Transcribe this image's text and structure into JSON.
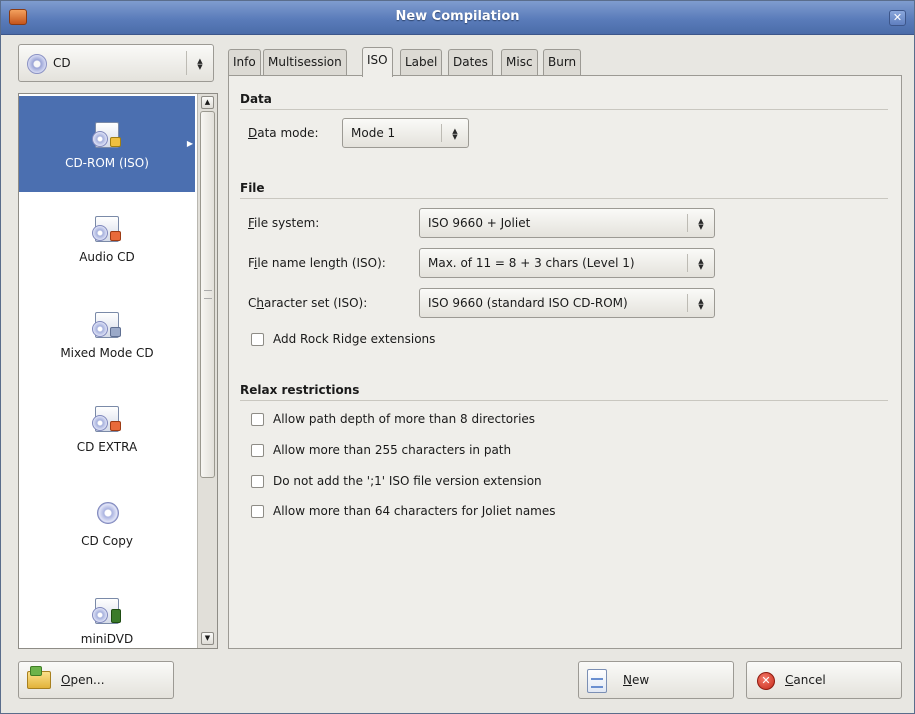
{
  "window": {
    "title": "New Compilation",
    "close_glyph": "✕"
  },
  "source_combo": {
    "value": "CD",
    "icon": "cd-icon"
  },
  "left_list": {
    "items": [
      {
        "label": "CD-ROM (ISO)",
        "icon": "cd-rom-iso-icon",
        "selected": true
      },
      {
        "label": "Audio CD",
        "icon": "audio-cd-icon",
        "selected": false
      },
      {
        "label": "Mixed Mode CD",
        "icon": "mixed-mode-cd-icon",
        "selected": false
      },
      {
        "label": "CD EXTRA",
        "icon": "cd-extra-icon",
        "selected": false
      },
      {
        "label": "CD Copy",
        "icon": "cd-copy-icon",
        "selected": false
      },
      {
        "label": "miniDVD",
        "icon": "minidvd-icon",
        "selected": false
      }
    ]
  },
  "tabs": [
    {
      "label": "Info",
      "active": false
    },
    {
      "label": "Multisession",
      "active": false
    },
    {
      "label": "ISO",
      "active": true
    },
    {
      "label": "Label",
      "active": false
    },
    {
      "label": "Dates",
      "active": false
    },
    {
      "label": "Misc",
      "active": false
    },
    {
      "label": "Burn",
      "active": false
    }
  ],
  "iso": {
    "data_section": {
      "title": "Data",
      "data_mode_label_accel": "D",
      "data_mode_label_rest": "ata mode:",
      "data_mode_value": "Mode 1"
    },
    "file_section": {
      "title": "File",
      "file_system_label_accel": "F",
      "file_system_label_rest": "ile system:",
      "file_system_value": "ISO 9660 + Joliet",
      "name_length_label_pre": "F",
      "name_length_label_accel": "i",
      "name_length_label_rest": "le name length (ISO):",
      "name_length_value": "Max. of 11 = 8 + 3 chars (Level 1)",
      "charset_label_pre": "C",
      "charset_label_accel": "h",
      "charset_label_rest": "aracter set (ISO):",
      "charset_value": "ISO 9660  (standard ISO CD-ROM)",
      "rock_ridge_label": "Add Rock Ridge extensions",
      "rock_ridge_checked": false
    },
    "relax_section": {
      "title": "Relax restrictions",
      "options": [
        {
          "label": "Allow path depth of more than 8 directories",
          "checked": false
        },
        {
          "label": "Allow more than 255 characters in path",
          "checked": false
        },
        {
          "label": "Do not add the ';1' ISO file version extension",
          "checked": false
        },
        {
          "label": "Allow more than 64 characters for Joliet names",
          "checked": false
        }
      ]
    }
  },
  "buttons": {
    "open_accel": "O",
    "open_rest": "pen...",
    "new_accel": "N",
    "new_rest": "ew",
    "cancel_accel": "C",
    "cancel_rest": "ancel"
  },
  "colors": {
    "titlebar": "#5a7cba",
    "selection": "#4b6fb0",
    "cancel_icon": "#c52a1a"
  }
}
